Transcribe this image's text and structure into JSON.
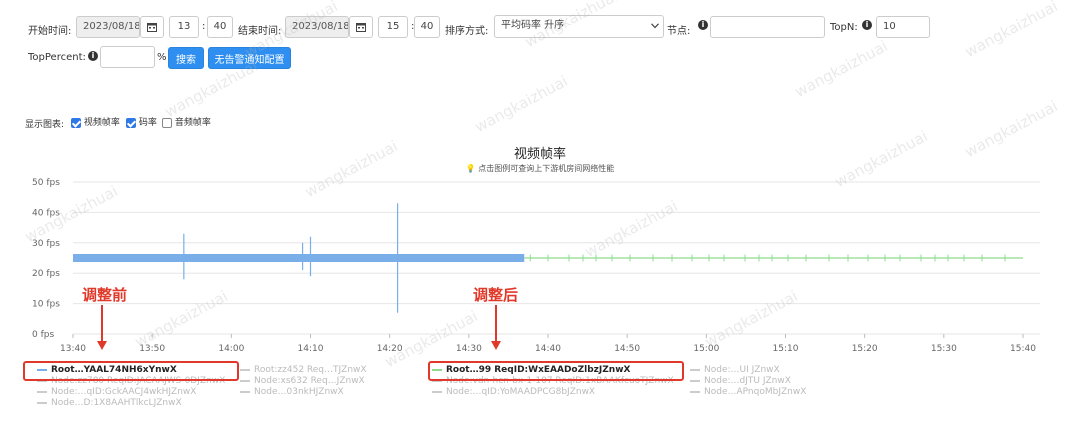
{
  "filters": {
    "start_label": "开始时间:",
    "start_date": "2023/08/18",
    "start_hour": "13",
    "start_minute": "40",
    "end_label": "结束时间:",
    "end_date": "2023/08/18",
    "end_hour": "15",
    "end_minute": "40",
    "sort_label": "排序方式:",
    "sort_value": "平均码率 升序",
    "node_label": "节点:",
    "node_value": "",
    "topn_label": "TopN:",
    "topn_value": "10",
    "toppercent_label": "TopPercent:",
    "toppercent_value": "",
    "percent_sign": "%",
    "search_button": "搜索",
    "config_button": "无告警通知配置",
    "time_sep": ":"
  },
  "display": {
    "label": "显示图表:",
    "options": [
      {
        "label": "视频帧率",
        "checked": true
      },
      {
        "label": "码率",
        "checked": true
      },
      {
        "label": "音频帧率",
        "checked": false
      }
    ]
  },
  "chart": {
    "title": "视频帧率",
    "subtitle": "点击图例可查询上下游机房间网络性能",
    "subtitle_icon": "lightbulb-icon",
    "colors": {
      "before": "#7aaee8",
      "after": "#8fdc8f",
      "grid": "#e6e6e6",
      "annotation": "#e0392a"
    }
  },
  "chart_data": {
    "type": "line",
    "title": "视频帧率",
    "ylim": [
      0,
      50
    ],
    "y_ticks": [
      "0 fps",
      "10 fps",
      "20 fps",
      "30 fps",
      "40 fps",
      "50 fps"
    ],
    "x_ticks": [
      "13:40",
      "13:50",
      "14:00",
      "14:10",
      "14:20",
      "14:30",
      "14:40",
      "14:50",
      "15:00",
      "15:10",
      "15:20",
      "15:30",
      "15:40"
    ],
    "series": [
      {
        "name": "Root…YAAL74NH6xYnwX",
        "segment": "before",
        "x_range": [
          "13:40",
          "14:37"
        ],
        "baseline": 25,
        "spikes": [
          {
            "x": "13:54",
            "low": 18,
            "high": 33
          },
          {
            "x": "14:09",
            "low": 21,
            "high": 30
          },
          {
            "x": "14:10",
            "low": 19,
            "high": 32
          },
          {
            "x": "14:21",
            "low": 7,
            "high": 43
          }
        ]
      },
      {
        "name": "Root…99 ReqID:WxEAADoZlbzJZnwX",
        "segment": "after",
        "x_range": [
          "14:37",
          "15:40"
        ],
        "baseline": 25,
        "spikes": []
      }
    ]
  },
  "annotations": {
    "before": "调整前",
    "after": "调整后"
  },
  "legend": [
    {
      "label": "Root…YAAL74NH6xYnwX",
      "active": true,
      "row": 0
    },
    {
      "label": "Root:zz452 Req…TJZnwX",
      "active": false,
      "row": 0
    },
    {
      "label": "Root…99 ReqID:WxEAADoZlbzJZnwX",
      "active": true,
      "row": 0
    },
    {
      "label": "Node:…UI JZnwX",
      "active": false,
      "row": 0
    },
    {
      "label": "Node:zz780 ReqID:JACAAJWS-0DJZnwX",
      "active": false,
      "row": 1
    },
    {
      "label": "Node:xs632 Req…JZnwX",
      "active": false,
      "row": 1
    },
    {
      "label": "Node:vdn-hcn-bx-1-107 ReqID:1xBAAKfcuoTJZnwX",
      "active": false,
      "row": 1
    },
    {
      "label": "Node:…dJTU JZnwX",
      "active": false,
      "row": 1
    },
    {
      "label": "Node:…qID:GckAACJ4wkHJZnwX",
      "active": false,
      "row": 2
    },
    {
      "label": "Node…03nkHJZnwX",
      "active": false,
      "row": 2
    },
    {
      "label": "Node:…qID:YoMAADPCG8bJZnwX",
      "active": false,
      "row": 2
    },
    {
      "label": "Node…APnqoMbJZnwX",
      "active": false,
      "row": 2
    },
    {
      "label": "Node…D:1X8AAHTlkcLJZnwX",
      "active": false,
      "row": 3
    }
  ],
  "watermark": "wangkaizhuai"
}
